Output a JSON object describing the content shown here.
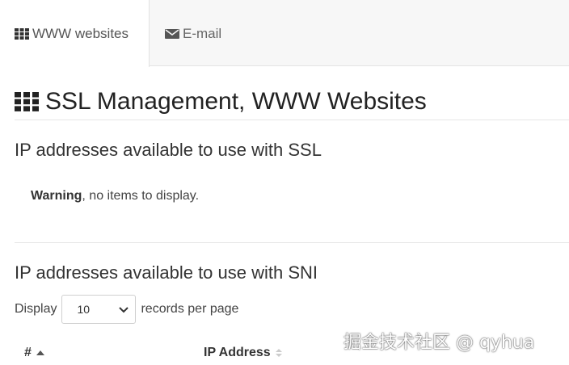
{
  "tabs": [
    {
      "label": "WWW websites",
      "icon": "grid-icon",
      "active": true
    },
    {
      "label": "E-mail",
      "icon": "envelope-icon",
      "active": false
    }
  ],
  "page": {
    "title": "SSL Management, WWW Websites",
    "icon": "grid-icon"
  },
  "ssl_section": {
    "title": "IP addresses available to use with SSL",
    "warning_label": "Warning",
    "warning_text": ", no items to display."
  },
  "sni_section": {
    "title": "IP addresses available to use with SNI",
    "display_label": "Display",
    "page_size": "10",
    "records_label": "records per page",
    "columns": [
      {
        "label": "#",
        "sort": "ascending"
      },
      {
        "label": "IP Address",
        "sort": "none"
      }
    ]
  },
  "watermark": "掘金技术社区 @ qyhua"
}
